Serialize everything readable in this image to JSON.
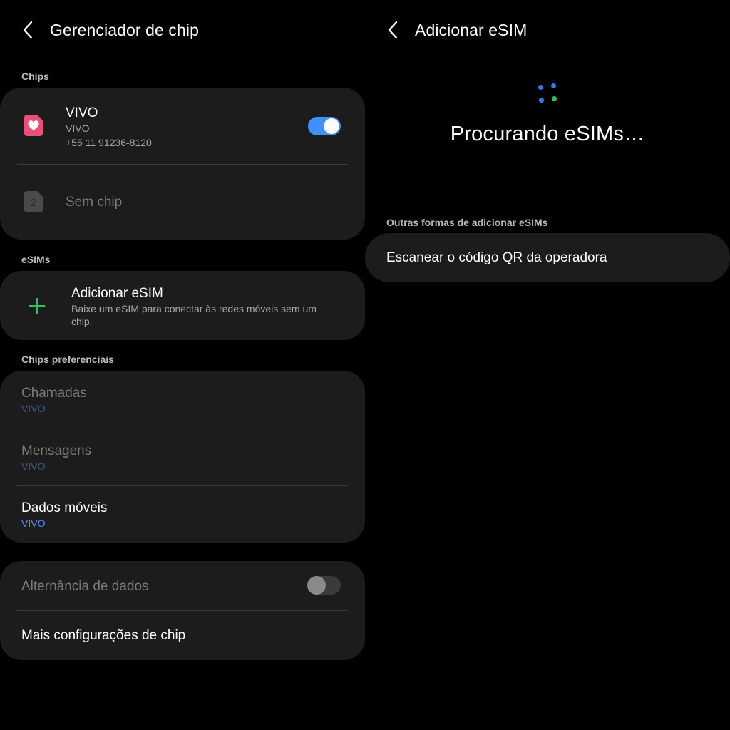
{
  "left_panel": {
    "title": "Gerenciador de chip",
    "chips_section": "Chips",
    "sim1": {
      "name": "VIVO",
      "carrier": "VIVO",
      "number": "+55 11 91236-8120",
      "enabled": true
    },
    "sim2": {
      "slot_number": "2",
      "label": "Sem chip"
    },
    "esims_section": "eSIMs",
    "add_esim": {
      "title": "Adicionar eSIM",
      "description_line1": "Baixe um eSIM para conectar às redes móveis sem um",
      "description_line2": "chip."
    },
    "preferred_section": "Chips preferenciais",
    "preferred": {
      "calls": {
        "title": "Chamadas",
        "value": "VIVO"
      },
      "messages": {
        "title": "Mensagens",
        "value": "VIVO"
      },
      "mobile_data": {
        "title": "Dados móveis",
        "value": "VIVO"
      }
    },
    "data_switching": {
      "label": "Alternância de dados",
      "enabled": false
    },
    "more_settings": "Mais configurações de chip"
  },
  "right_panel": {
    "title": "Adicionar eSIM",
    "searching": "Procurando eSIMs…",
    "other_ways_section": "Outras formas de adicionar eSIMs",
    "scan_qr": "Escanear o código QR da operadora"
  },
  "colors": {
    "accent_blue": "#3e91ff",
    "sim_pink": "#e9507a",
    "plus_green": "#2fbf63",
    "card_bg": "#1c1c1c"
  },
  "icons": [
    "back-arrow-icon",
    "sim-card-heart-icon",
    "sim-card-slot-icon",
    "plus-icon",
    "loading-dots-icon"
  ]
}
